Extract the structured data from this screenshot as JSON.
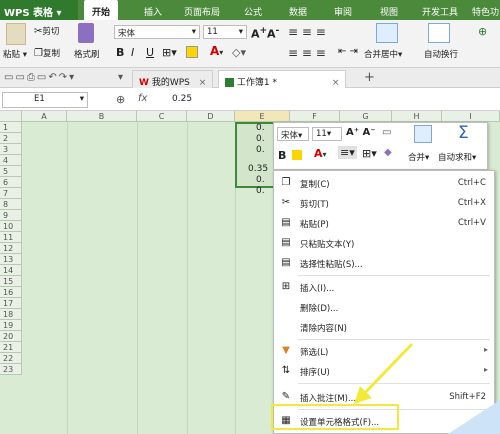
{
  "app": {
    "name": "WPS 表格"
  },
  "menu_tabs": [
    "开始",
    "插入",
    "页面布局",
    "公式",
    "数据",
    "审阅",
    "视图",
    "开发工具",
    "特色功"
  ],
  "ribbon": {
    "paste": "粘贴",
    "cut": "剪切",
    "copy": "复制",
    "format_painter": "格式刷",
    "font_name": "宋体",
    "font_size": "11",
    "merge_center": "合并居中",
    "wrap_text": "自动换行",
    "bold": "B",
    "italic": "I",
    "underline": "U",
    "grow_font": "A",
    "shrink_font": "A"
  },
  "doc_tabs": [
    {
      "label": "我的WPS"
    },
    {
      "label": "工作簿1 *"
    }
  ],
  "formula_bar": {
    "cell_ref": "E1",
    "fx": "fx",
    "value": "0.25"
  },
  "grid": {
    "columns": [
      "A",
      "B",
      "C",
      "D",
      "E",
      "F",
      "G",
      "H",
      "I"
    ],
    "rows": [
      "1",
      "2",
      "3",
      "4",
      "5",
      "6",
      "7",
      "8",
      "9",
      "10",
      "11",
      "12",
      "13",
      "14",
      "15",
      "16",
      "17",
      "18",
      "19",
      "20",
      "21",
      "22",
      "23"
    ],
    "e_values": [
      "0.",
      "0.",
      "0.",
      "0.35",
      "0.",
      "0."
    ]
  },
  "mini_toolbar": {
    "font_name": "宋体",
    "font_size": "11",
    "merge": "合并",
    "autosum": "自动求和",
    "bold": "B"
  },
  "context_menu": [
    {
      "label": "复制(C)",
      "shortcut": "Ctrl+C",
      "icon": "copy-icon"
    },
    {
      "label": "剪切(T)",
      "shortcut": "Ctrl+X",
      "icon": "scissors-icon"
    },
    {
      "label": "粘贴(P)",
      "shortcut": "Ctrl+V",
      "icon": "paste-icon"
    },
    {
      "label": "只粘贴文本(Y)",
      "shortcut": "",
      "icon": "paste-text-icon"
    },
    {
      "label": "选择性粘贴(S)...",
      "shortcut": "",
      "icon": "paste-special-icon"
    },
    {
      "label": "插入(I)...",
      "shortcut": "",
      "icon": "insert-icon"
    },
    {
      "label": "删除(D)...",
      "shortcut": "",
      "icon": ""
    },
    {
      "label": "清除内容(N)",
      "shortcut": "",
      "icon": ""
    },
    {
      "label": "筛选(L)",
      "shortcut": "",
      "icon": "filter-icon",
      "submenu": true
    },
    {
      "label": "排序(U)",
      "shortcut": "",
      "icon": "sort-icon",
      "submenu": true
    },
    {
      "label": "插入批注(M)...",
      "shortcut": "Shift+F2",
      "icon": "comment-icon"
    },
    {
      "label": "设置单元格格式(F)...",
      "shortcut": "",
      "icon": "format-cells-icon"
    }
  ],
  "colors": {
    "accent": "#4b8a3a",
    "grid_bg": "#d9ebd3",
    "highlight": "#f2e93a"
  }
}
